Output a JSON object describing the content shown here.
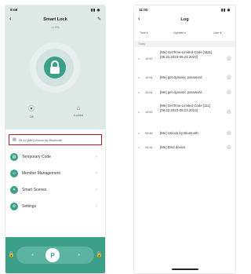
{
  "screen1": {
    "status_time": "9:08",
    "status_signals": "▮▮ ◉",
    "title": "Smart Lock",
    "battery": "▭ 0%",
    "quick": [
      {
        "icon": "⦿",
        "label": "Off"
      },
      {
        "icon": "⌂",
        "label": "Locked"
      }
    ],
    "log_preview": "09:42  [Me]  Unlock by Bluetooth",
    "menu": [
      {
        "label": "Temporary Code",
        "icon": "▤"
      },
      {
        "label": "Member Management",
        "icon": "☺"
      },
      {
        "label": "Smart Scenes",
        "icon": "✶"
      },
      {
        "label": "Settings",
        "icon": "⚙"
      }
    ],
    "unlock_letter": "P",
    "accent": "#3c9f89"
  },
  "screen2": {
    "status_time": "11:00",
    "status_signals": "▮▮ ◉",
    "title": "Log",
    "filters": [
      "Time ▾",
      "Operate ▾",
      "User ▾"
    ],
    "section": "Today",
    "entries": [
      {
        "time": "10:50",
        "text": "[Me]  GetTime-Limited Code [1111] [09.22.2023-09.23.2023]"
      },
      {
        "time": "10:54",
        "text": "[Me]  get dynamic password"
      },
      {
        "time": "10:54",
        "text": "[Me]  get dynamic password"
      },
      {
        "time": "10:53",
        "text": "[Me]  GetTime-Limited Code [111] [09.22.2023-09.23.2023]"
      },
      {
        "time": "09:45",
        "text": "[Me]  Unlock by Bluetooth"
      },
      {
        "time": "09:44",
        "text": "[Me]  Bind device"
      }
    ]
  }
}
